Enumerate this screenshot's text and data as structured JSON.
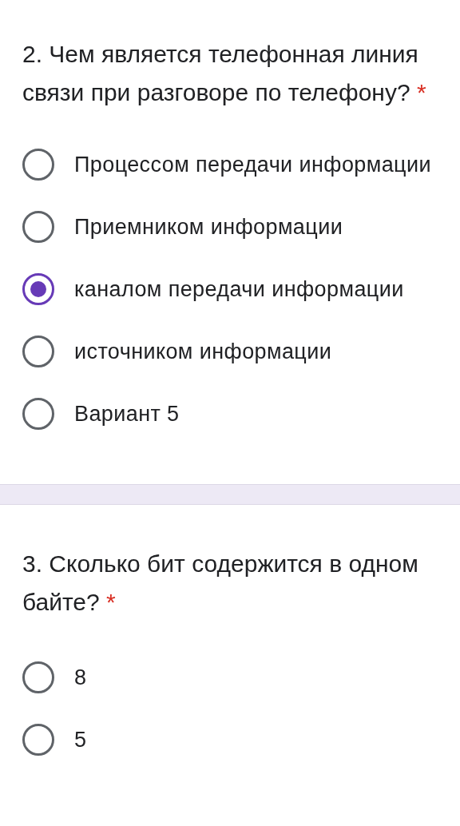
{
  "questions": [
    {
      "title": "2. Чем является телефонная линия связи при разговоре по телефону?",
      "required_mark": "*",
      "options": [
        {
          "label": "Процессом передачи информации",
          "selected": false
        },
        {
          "label": "Приемником информации",
          "selected": false
        },
        {
          "label": "каналом передачи информации",
          "selected": true
        },
        {
          "label": "источником информации",
          "selected": false
        },
        {
          "label": "Вариант 5",
          "selected": false
        }
      ]
    },
    {
      "title": "3. Сколько бит содержится в одном байте?",
      "required_mark": "*",
      "options": [
        {
          "label": "8",
          "selected": false
        },
        {
          "label": "5",
          "selected": false
        }
      ]
    }
  ]
}
